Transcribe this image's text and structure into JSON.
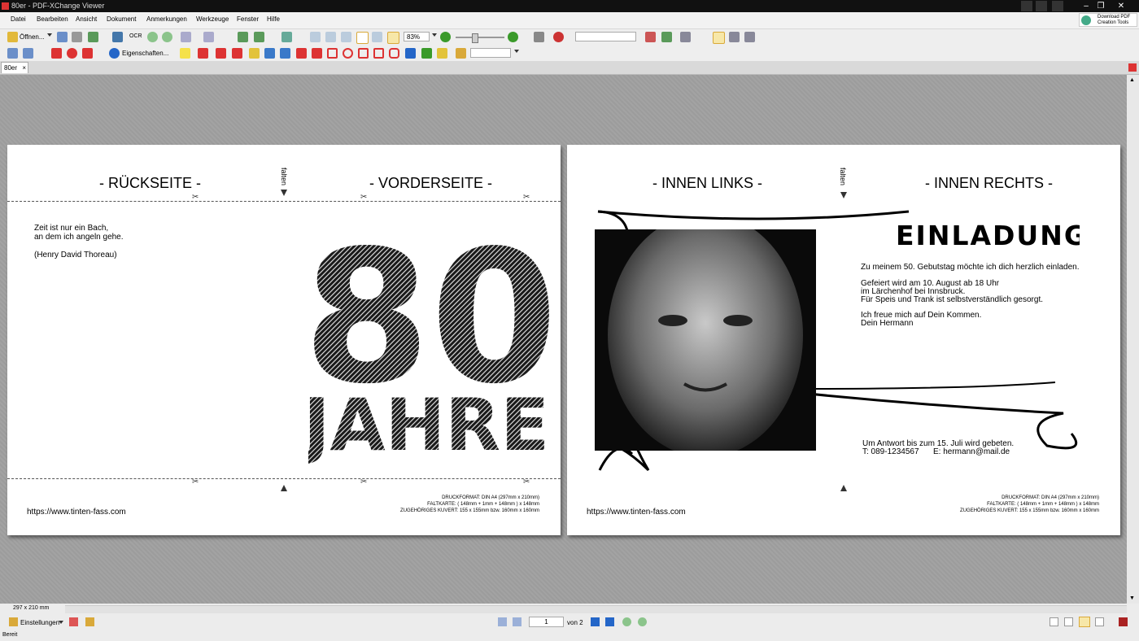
{
  "window": {
    "title": "80er - PDF-XChange Viewer"
  },
  "window_controls": {
    "minimize": "–",
    "restore": "❐",
    "close": "✕"
  },
  "download": {
    "line1": "Download PDF",
    "line2": "Creation Tools"
  },
  "menu": [
    "Datei",
    "Bearbeiten",
    "Ansicht",
    "Dokument",
    "Anmerkungen",
    "Werkzeuge",
    "Fenster",
    "Hilfe"
  ],
  "toolbar1": {
    "open_label": "Öffnen...",
    "ocr_label": "OCR",
    "zoom_value": "83%"
  },
  "toolbar2": {
    "properties_label": "Eigenschaften..."
  },
  "tab": {
    "label": "80er",
    "close": "×"
  },
  "page_left": {
    "heading_left": "-  RÜCKSEITE -",
    "heading_right": "- VORDERSEITE -",
    "fold_label": "falten",
    "quote_lines": [
      "Zeit ist nur ein Bach,",
      "an dem ich angeln gehe."
    ],
    "quote_author": "(Henry David Thoreau)",
    "big_number": "80",
    "big_word": "JAHRE",
    "url": "https://www.tinten-fass.com",
    "print_info": [
      "DRUCKFORMAT: DIN A4 (297mm x 210mm)",
      "FALTKARTE:  ( 148mm + 1mm + 148mm ) x 148mm",
      "ZUGEHÖRIGES KUVERT: 155 x 155mm bzw. 160mm x 160mm"
    ]
  },
  "page_right": {
    "heading_left": "-  INNEN LINKS -",
    "heading_right": "- INNEN RECHTS -",
    "fold_label": "falten",
    "title": "EINLADUNG",
    "line1": "Zu meinem 50. Gebutstag möchte ich dich herzlich einladen.",
    "para2": [
      "Gefeiert wird am 10. August ab 18 Uhr",
      "im Lärchenhof bei Innsbruck.",
      "Für Speis und Trank ist selbstverständlich gesorgt."
    ],
    "para3": [
      "Ich freue mich auf Dein Kommen.",
      "Dein Hermann"
    ],
    "rsvp": "Um Antwort bis zum 15. Juli wird gebeten.",
    "phone": "T: 089-1234567",
    "email": "E: hermann@mail.de",
    "url": "https://www.tinten-fass.com",
    "print_info": [
      "DRUCKFORMAT: DIN A4 (297mm x 210mm)",
      "FALTKARTE:  ( 148mm + 1mm + 148mm ) x 148mm",
      "ZUGEHÖRIGES KUVERT: 155 x 155mm bzw. 160mm x 160mm"
    ]
  },
  "status": {
    "page_size": "297 x 210 mm",
    "settings_label": "Einstellungen",
    "page_input": "1",
    "page_of": "von 2",
    "ready": "Bereit"
  },
  "colors": {
    "accent_green": "#3a9a2a",
    "accent_blue": "#2466c8",
    "titlebar": "#111111"
  }
}
